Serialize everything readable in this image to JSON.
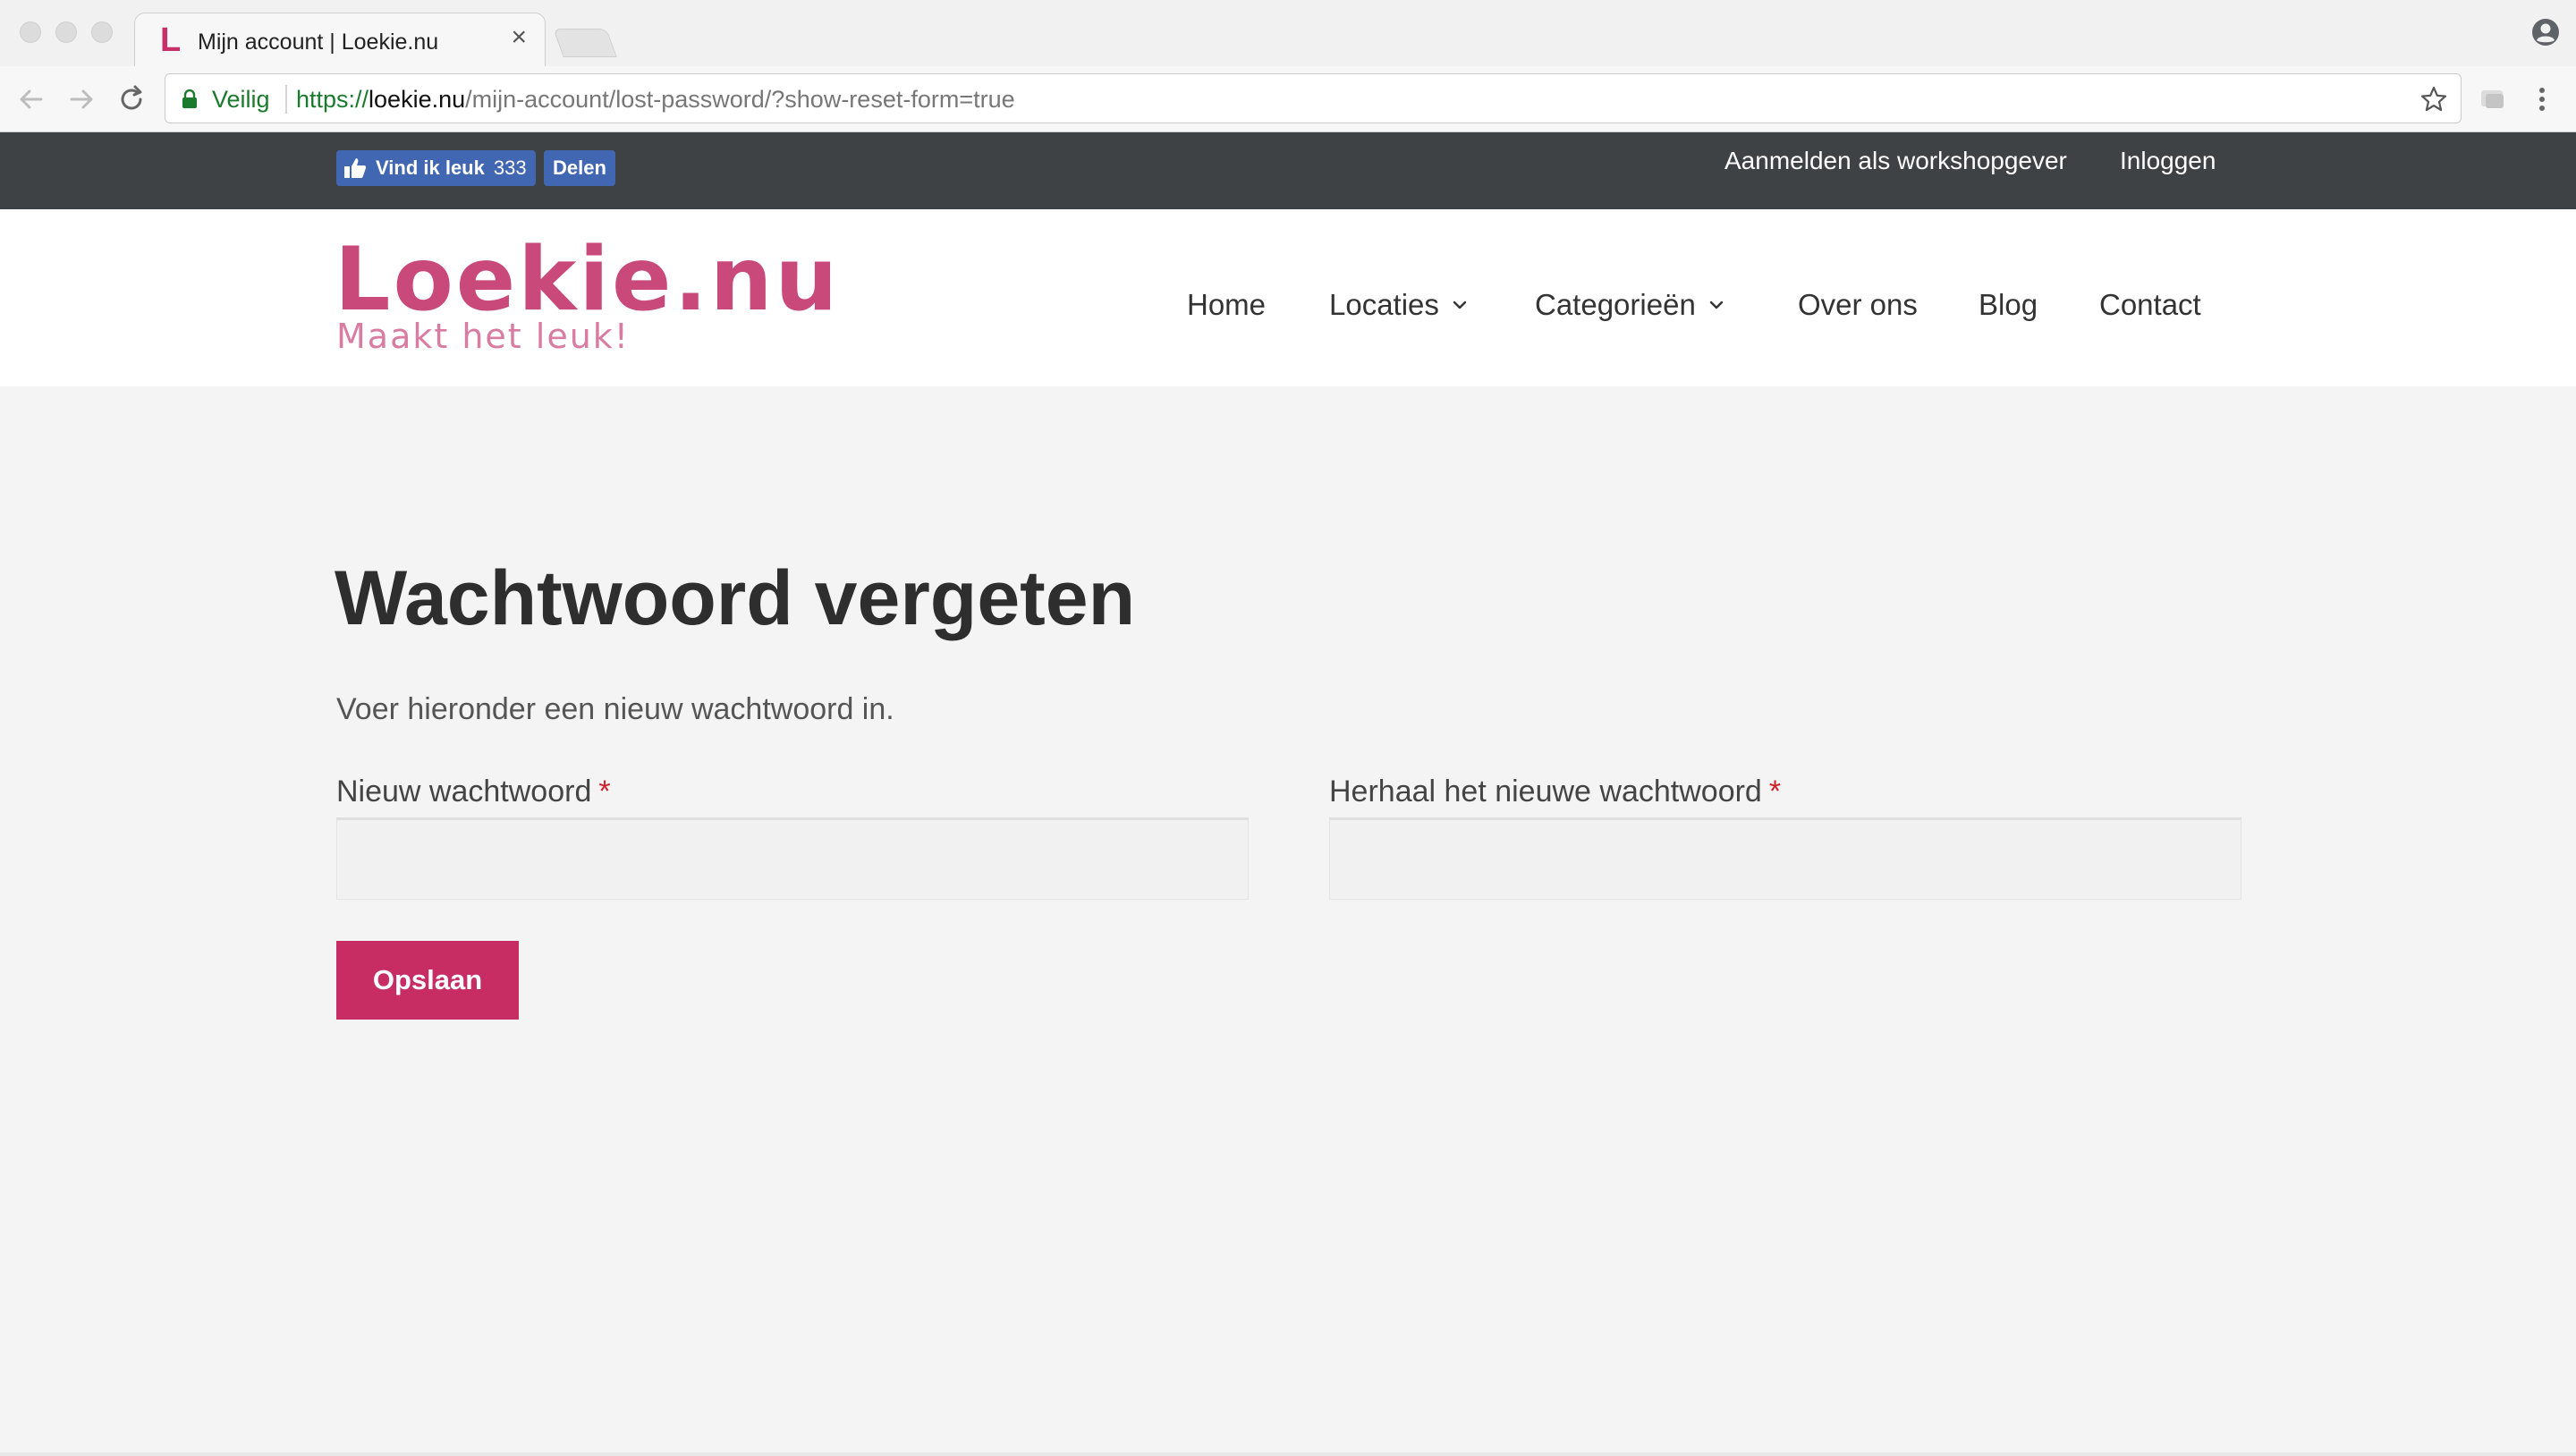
{
  "browser": {
    "tab_title": "Mijn account | Loekie.nu",
    "favicon_letter": "L",
    "close_glyph": "×",
    "secure_label": "Veilig",
    "url_scheme": "https://",
    "url_host": "loekie.nu",
    "url_path": "/mijn-account/lost-password/?show-reset-form=true"
  },
  "topbar": {
    "like_label": "Vind ik leuk",
    "like_count": "333",
    "share_label": "Delen",
    "register_link": "Aanmelden als workshopgever",
    "login_link": "Inloggen"
  },
  "header": {
    "logo": "Loekie.nu",
    "tagline": "Maakt het leuk!",
    "nav": {
      "home": "Home",
      "locaties": "Locaties",
      "categorieen": "Categorieën",
      "over_ons": "Over ons",
      "blog": "Blog",
      "contact": "Contact"
    }
  },
  "main": {
    "title": "Wachtwoord vergeten",
    "intro": "Voer hieronder een nieuw wachtwoord in.",
    "new_password_label": "Nieuw wachtwoord",
    "repeat_password_label": "Herhaal het nieuwe wachtwoord",
    "required_marker": "*",
    "new_password_value": "",
    "repeat_password_value": "",
    "save_label": "Opslaan"
  },
  "colors": {
    "brand": "#c9497a",
    "button": "#c72d63",
    "topbar": "#3e4245",
    "facebook": "#4267b2"
  }
}
